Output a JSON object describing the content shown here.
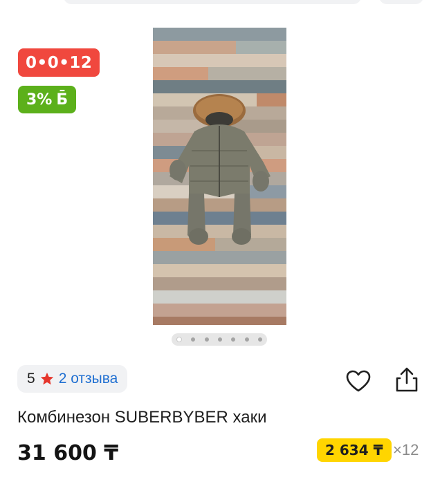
{
  "badges": {
    "installment": "0•0•12",
    "bonus_percent": "3%",
    "bonus_symbol": "Б̄"
  },
  "gallery": {
    "image_alt_icon": "product-photo",
    "dots_total": 7,
    "active_index": 0
  },
  "rating": {
    "value": "5",
    "reviews": "2 отзыва"
  },
  "actions": {
    "favorite_icon": "heart-icon",
    "share_icon": "share-icon"
  },
  "product": {
    "title": "Комбинезон SUBERBYBER хаки",
    "price": "31 600 ₸",
    "monthly": "2 634 ₸",
    "months": "×12"
  },
  "colors": {
    "installment_badge": "#f0483e",
    "bonus_badge": "#5cb01b",
    "monthly_badge": "#ffd500",
    "link": "#1f6fd1",
    "star": "#e5352b"
  }
}
